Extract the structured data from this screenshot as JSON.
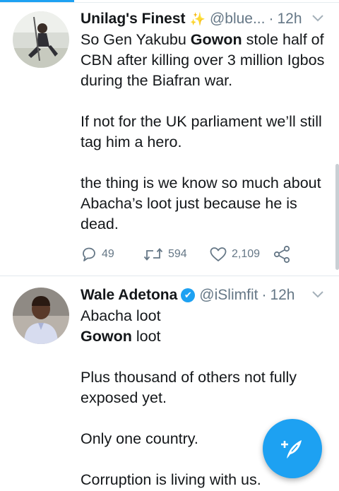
{
  "tweets": [
    {
      "name": "Unilag's Finest",
      "name_badge": "✨",
      "handle": "@blue...",
      "dot": "·",
      "time": "12h",
      "lines": [
        {
          "pre": "So Gen Yakubu ",
          "bold": "Gowon",
          "post": " stole half of"
        },
        {
          "text": "CBN after killing over 3 million Igbos"
        },
        {
          "text": "during the Biafran war."
        },
        {
          "text": ""
        },
        {
          "text": "If not for the UK parliament we’ll still"
        },
        {
          "text": "tag him a hero."
        },
        {
          "text": ""
        },
        {
          "text": "the thing is we know so much about"
        },
        {
          "text": "Abacha’s loot just because he is"
        },
        {
          "text": "dead."
        }
      ],
      "replies": "49",
      "retweets": "594",
      "likes": "2,109"
    },
    {
      "name": "Wale Adetona",
      "verified_mark": "✔",
      "handle": "@iSlimfit",
      "dot": "·",
      "time": "12h",
      "lines": [
        {
          "text": "Abacha loot"
        },
        {
          "bold": "Gowon",
          "post": " loot"
        },
        {
          "text": ""
        },
        {
          "text": "Plus thousand of others not fully"
        },
        {
          "text": "exposed yet."
        },
        {
          "text": ""
        },
        {
          "text": "Only one country."
        },
        {
          "text": ""
        },
        {
          "text": "Corruption is living with us."
        }
      ]
    }
  ],
  "colors": {
    "accent": "#1da1f2",
    "secondary_text": "#657786",
    "primary_text": "#14171a",
    "divider": "#e1e8ed"
  },
  "icons": [
    "caret-down-icon",
    "reply-icon",
    "retweet-icon",
    "like-icon",
    "share-icon",
    "compose-tweet-icon",
    "verified-icon",
    "sparkles-icon"
  ]
}
